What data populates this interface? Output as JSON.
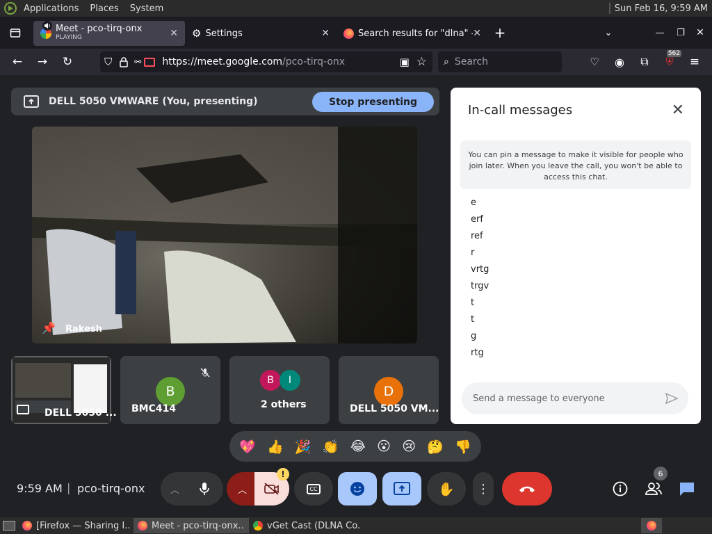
{
  "gnome": {
    "menu": [
      "Applications",
      "Places",
      "System"
    ],
    "clock": "Sun Feb 16,  9:59 AM"
  },
  "tabs": [
    {
      "title": "Meet - pco-tirq-onx",
      "sub": "PLAYING"
    },
    {
      "title": "Settings"
    },
    {
      "title": "Search results for \"dlna\" – A"
    }
  ],
  "nav": {
    "url_host": "https://meet.google.com",
    "url_path": "/pco-tirq-onx",
    "search_placeholder": "Search",
    "badge": "562"
  },
  "meet": {
    "banner_text": "DELL 5050 VMWARE (You, presenting)",
    "stop_label": "Stop presenting",
    "main_name": "Rakesh",
    "tiles": [
      {
        "name": "DELL 5050 ..."
      },
      {
        "name": "BMC414",
        "initial": "B",
        "color": "#5f9e33"
      },
      {
        "name": "2 others",
        "initial1": "B",
        "initial2": "I",
        "color1": "#c2185b",
        "color2": "#00897b"
      },
      {
        "name": "DELL 5050 VM...",
        "initial": "D",
        "color": "#e8710a"
      }
    ]
  },
  "chat": {
    "title": "In-call messages",
    "pin_note": "You can pin a message to make it visible for people who join later. When you leave the call, you won't be able to access this chat.",
    "messages": [
      "e",
      "erf",
      "ref",
      "r",
      "vrtg",
      "trgv",
      "t",
      "t",
      "g",
      "rtg"
    ],
    "input_placeholder": "Send a message to everyone"
  },
  "reactions": [
    "💖",
    "👍",
    "🎉",
    "👏",
    "😂",
    "😮",
    "😢",
    "🤔",
    "👎"
  ],
  "controls": {
    "time": "9:59 AM",
    "separator": "|",
    "meeting_code": "pco-tirq-onx",
    "people_count": "6",
    "alert": "!"
  },
  "taskbar": [
    {
      "label": "[Firefox — Sharing I..."
    },
    {
      "label": "Meet - pco-tirq-onx..."
    },
    {
      "label": "vGet Cast (DLNA Co..."
    }
  ]
}
